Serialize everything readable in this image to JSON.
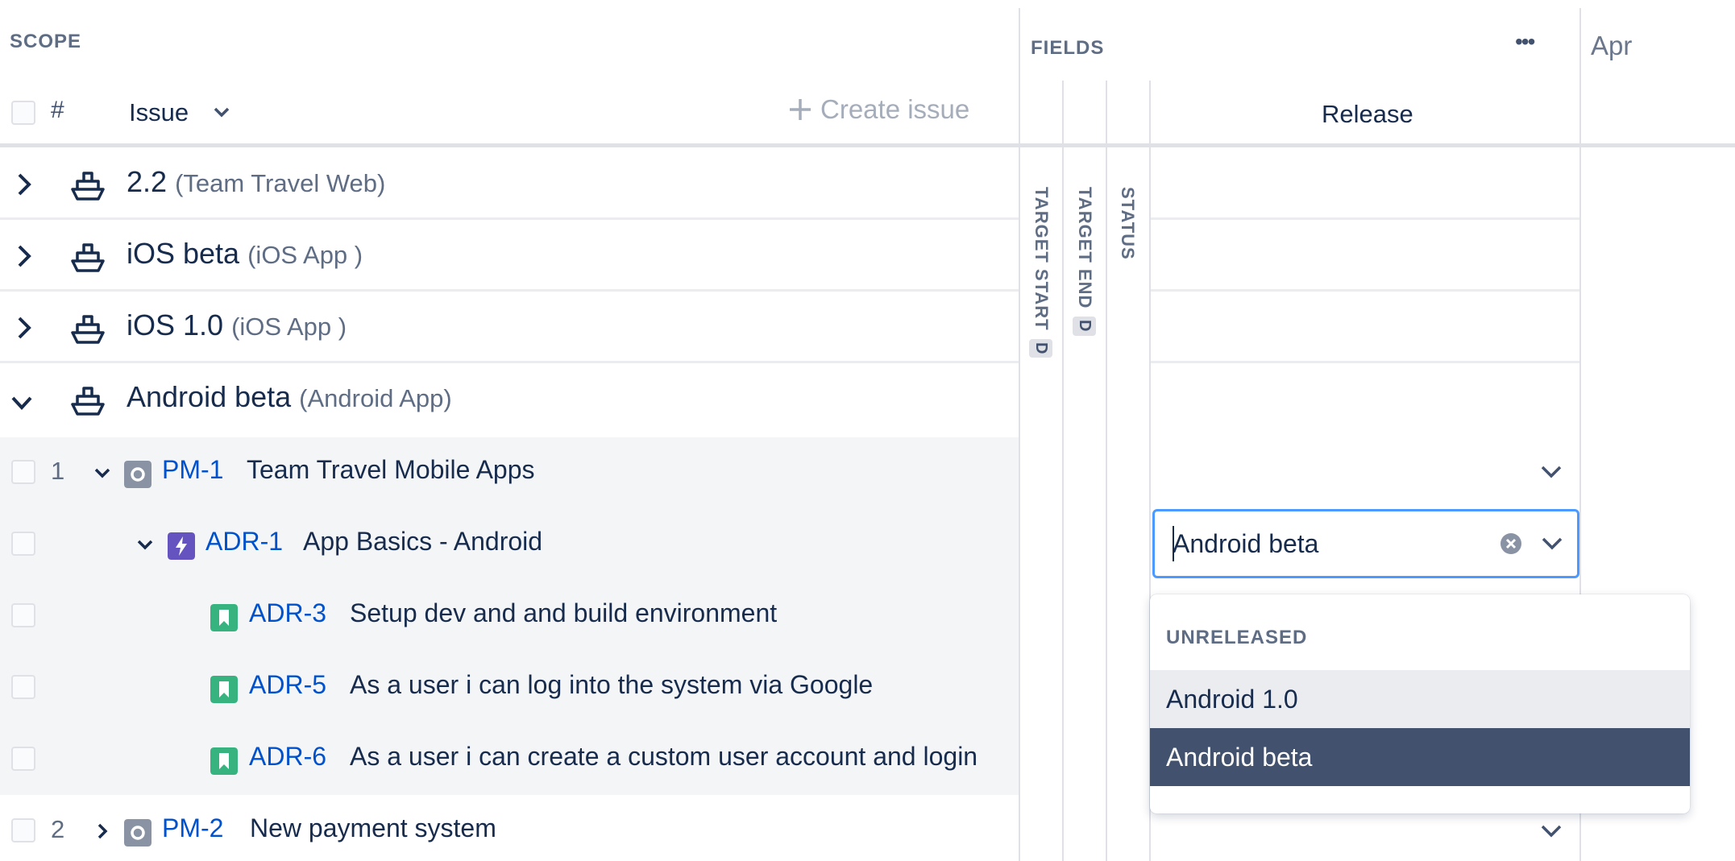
{
  "scope": {
    "header_label": "SCOPE",
    "col_number": "#",
    "col_issue": "Issue",
    "create_issue": "Create issue"
  },
  "fields": {
    "header_label": "FIELDS",
    "more": "•••",
    "columns": [
      {
        "label": "TARGET START",
        "badge": "D"
      },
      {
        "label": "TARGET END",
        "badge": "D"
      },
      {
        "label": "STATUS"
      }
    ],
    "release_col": "Release"
  },
  "timeline": {
    "month": "Apr"
  },
  "groups": [
    {
      "name": "2.2",
      "project": "(Team Travel Web)",
      "expanded": false
    },
    {
      "name": "iOS beta",
      "project": "(iOS App )",
      "expanded": false
    },
    {
      "name": "iOS 1.0",
      "project": "(iOS App )",
      "expanded": false
    },
    {
      "name": "Android beta",
      "project": "(Android App)",
      "expanded": true
    }
  ],
  "issues": [
    {
      "num": "1",
      "key": "PM-1",
      "title": "Team Travel Mobile Apps",
      "type": "epic-icon"
    },
    {
      "num": "",
      "key": "ADR-1",
      "title": "App Basics - Android",
      "type": "lightning-icon"
    },
    {
      "num": "",
      "key": "ADR-3",
      "title": "Setup dev and and build environment",
      "type": "bookmark-icon"
    },
    {
      "num": "",
      "key": "ADR-5",
      "title": "As a user i can log into the system via Google",
      "type": "bookmark-icon"
    },
    {
      "num": "",
      "key": "ADR-6",
      "title": "As a user i can create a custom user account and login",
      "type": "bookmark-icon"
    },
    {
      "num": "2",
      "key": "PM-2",
      "title": "New payment system",
      "type": "epic-icon"
    }
  ],
  "release_select": {
    "value": "Android beta",
    "group_label": "UNRELEASED",
    "options": [
      "Android 1.0",
      "Android beta"
    ]
  },
  "colors": {
    "link": "#0052cc",
    "epic": "#8993a4",
    "task": "#6554c0",
    "story": "#36b37e",
    "focus": "#4c9aff",
    "selected": "#42526e"
  }
}
